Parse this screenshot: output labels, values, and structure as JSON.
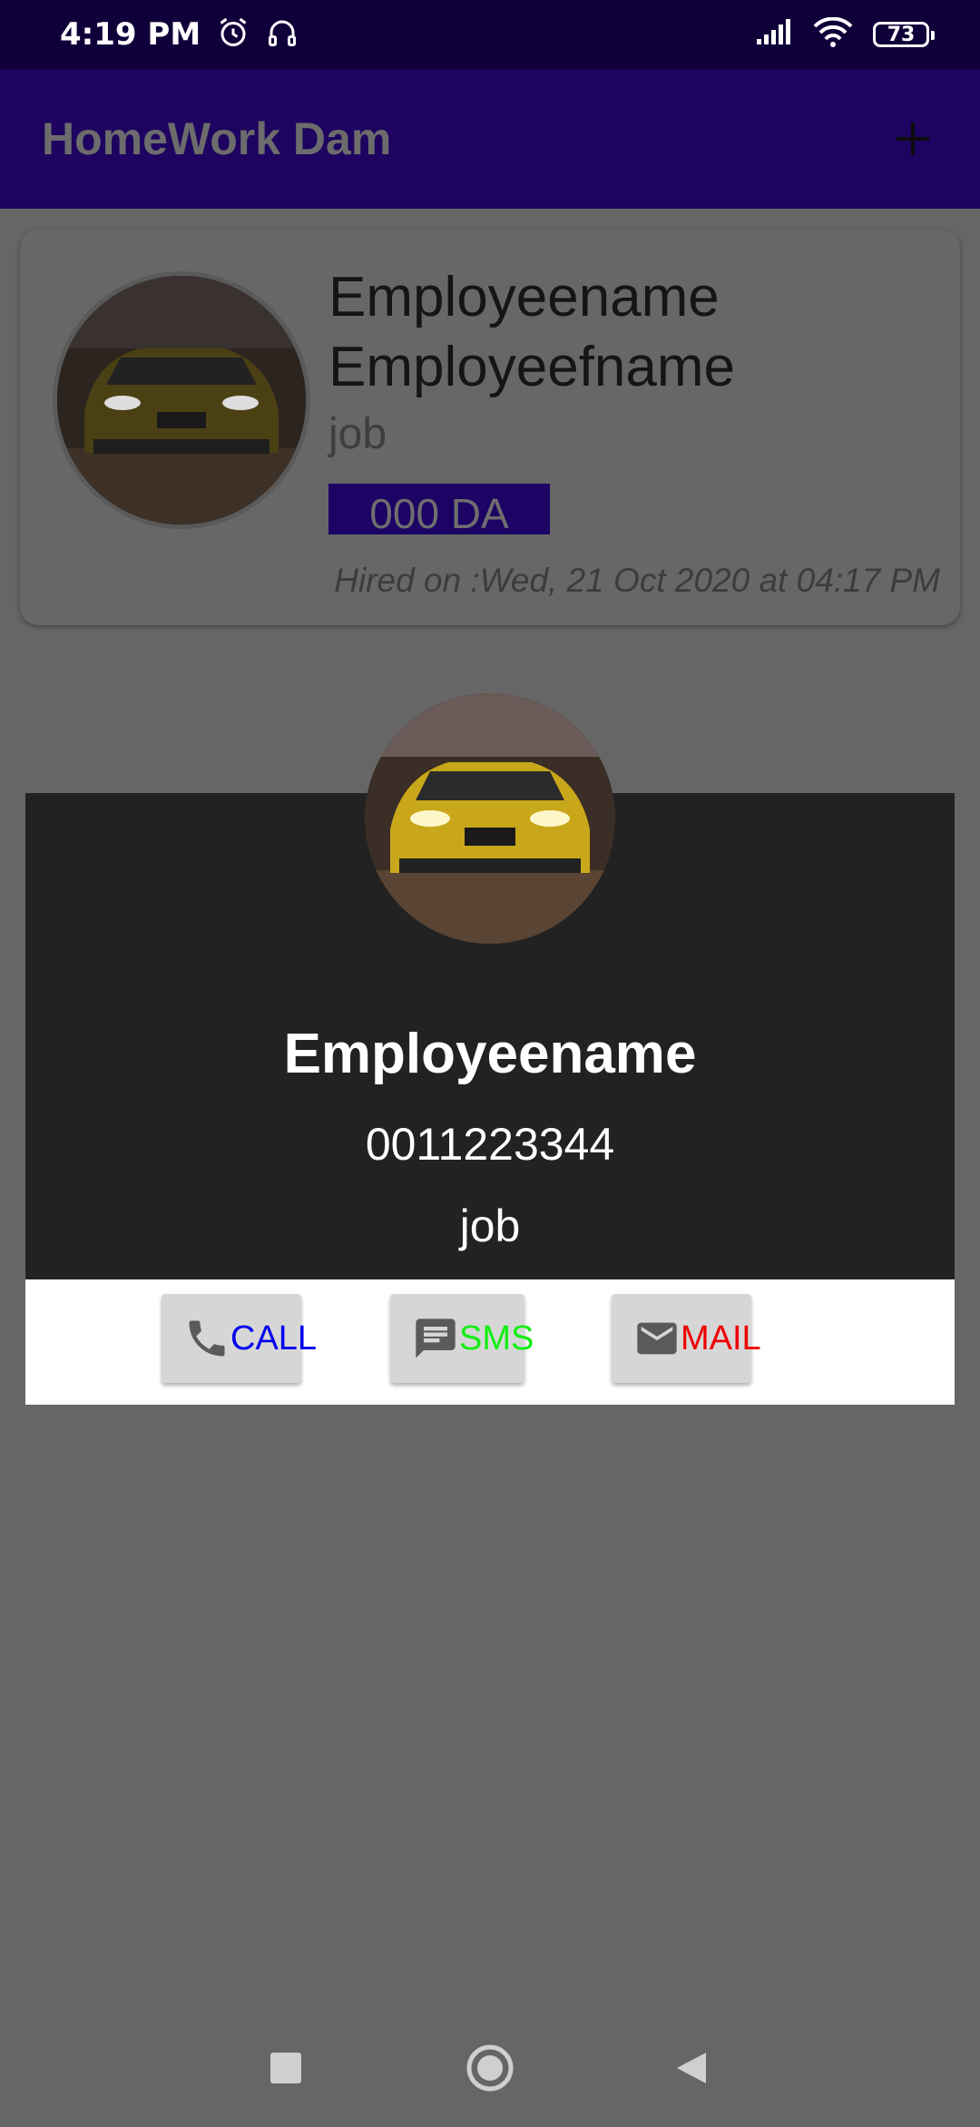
{
  "status_bar": {
    "time": "4:19 PM",
    "battery": "73"
  },
  "app_bar": {
    "title": "HomeWork Dam",
    "add_icon": "plus-icon"
  },
  "employee_card": {
    "name": "Employeename Employeefname",
    "job": "job",
    "salary": "000 DA",
    "hired": "Hired on :Wed, 21 Oct 2020 at 04:17 PM",
    "salary_color": "#1c0364"
  },
  "contact_dialog": {
    "name": "Employeename",
    "phone": "0011223344",
    "job": "job",
    "actions": [
      {
        "label": "CALL",
        "icon": "phone-icon",
        "color": "#0000ee"
      },
      {
        "label": "SMS",
        "icon": "message-icon",
        "color": "#11ee11"
      },
      {
        "label": "MAIL",
        "icon": "mail-icon",
        "color": "#ee0000"
      }
    ]
  },
  "nav": {
    "icons": [
      "recents-square-icon",
      "home-circle-icon",
      "back-triangle-icon"
    ]
  },
  "colors": {
    "status_bar": "#10003a",
    "app_bar": "#1e0460",
    "scrim": "#666666",
    "dialog_dark": "#222222"
  }
}
